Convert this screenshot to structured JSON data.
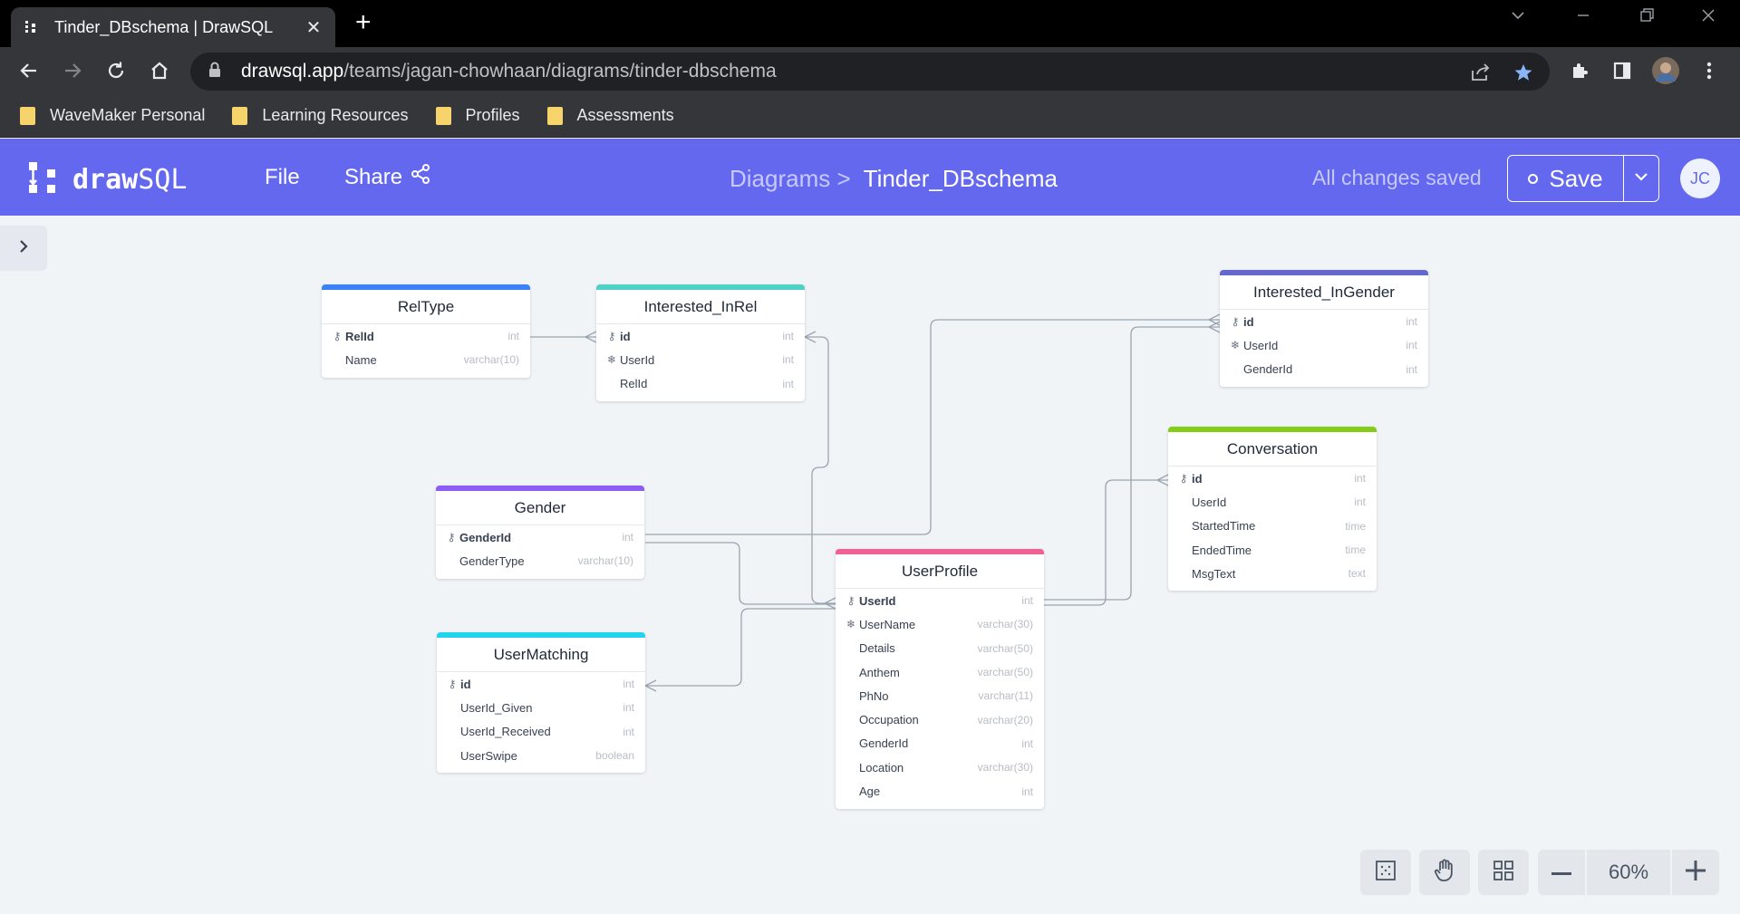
{
  "browser": {
    "tab_title": "Tinder_DBschema | DrawSQL",
    "url_host": "drawsql.app",
    "url_path": "/teams/jagan-chowhaan/diagrams/tinder-dbschema",
    "bookmarks": [
      "WaveMaker Personal",
      "Learning Resources",
      "Profiles",
      "Assessments"
    ]
  },
  "app": {
    "logo_bold": "draw",
    "logo_light": "SQL",
    "menu_file": "File",
    "menu_share": "Share",
    "breadcrumb_parent": "Diagrams >",
    "breadcrumb_current": "Tinder_DBschema",
    "status": "All changes saved",
    "save_label": "Save",
    "avatar_initials": "JC",
    "accent": "#6468ee"
  },
  "tables": {
    "reltype": {
      "name": "RelType",
      "color": "#3b82f6",
      "columns": [
        {
          "name": "RelId",
          "type": "int"
        },
        {
          "name": "Name",
          "type": "varchar(10)"
        }
      ]
    },
    "interested_inrel": {
      "name": "Interested_InRel",
      "color": "#4fd1c5",
      "columns": [
        {
          "name": "id",
          "type": "int"
        },
        {
          "name": "UserId",
          "type": "int"
        },
        {
          "name": "RelId",
          "type": "int"
        }
      ]
    },
    "interested_ingender": {
      "name": "Interested_InGender",
      "color": "#6468ce",
      "columns": [
        {
          "name": "id",
          "type": "int"
        },
        {
          "name": "UserId",
          "type": "int"
        },
        {
          "name": "GenderId",
          "type": "int"
        }
      ]
    },
    "conversation": {
      "name": "Conversation",
      "color": "#84cc16",
      "columns": [
        {
          "name": "id",
          "type": "int"
        },
        {
          "name": "UserId",
          "type": "int"
        },
        {
          "name": "StartedTime",
          "type": "time"
        },
        {
          "name": "EndedTime",
          "type": "time"
        },
        {
          "name": "MsgText",
          "type": "text"
        }
      ]
    },
    "gender": {
      "name": "Gender",
      "color": "#8b5cf6",
      "columns": [
        {
          "name": "GenderId",
          "type": "int"
        },
        {
          "name": "GenderType",
          "type": "varchar(10)"
        }
      ]
    },
    "usermatching": {
      "name": "UserMatching",
      "color": "#22d3ee",
      "columns": [
        {
          "name": "id",
          "type": "int"
        },
        {
          "name": "UserId_Given",
          "type": "int"
        },
        {
          "name": "UserId_Received",
          "type": "int"
        },
        {
          "name": "UserSwipe",
          "type": "boolean"
        }
      ]
    },
    "userprofile": {
      "name": "UserProfile",
      "color": "#f06292",
      "columns": [
        {
          "name": "UserId",
          "type": "int"
        },
        {
          "name": "UserName",
          "type": "varchar(30)"
        },
        {
          "name": "Details",
          "type": "varchar(50)"
        },
        {
          "name": "Anthem",
          "type": "varchar(50)"
        },
        {
          "name": "PhNo",
          "type": "varchar(11)"
        },
        {
          "name": "Occupation",
          "type": "varchar(20)"
        },
        {
          "name": "GenderId",
          "type": "int"
        },
        {
          "name": "Location",
          "type": "varchar(30)"
        },
        {
          "name": "Age",
          "type": "int"
        }
      ]
    }
  },
  "zoom": {
    "value": "60%"
  }
}
